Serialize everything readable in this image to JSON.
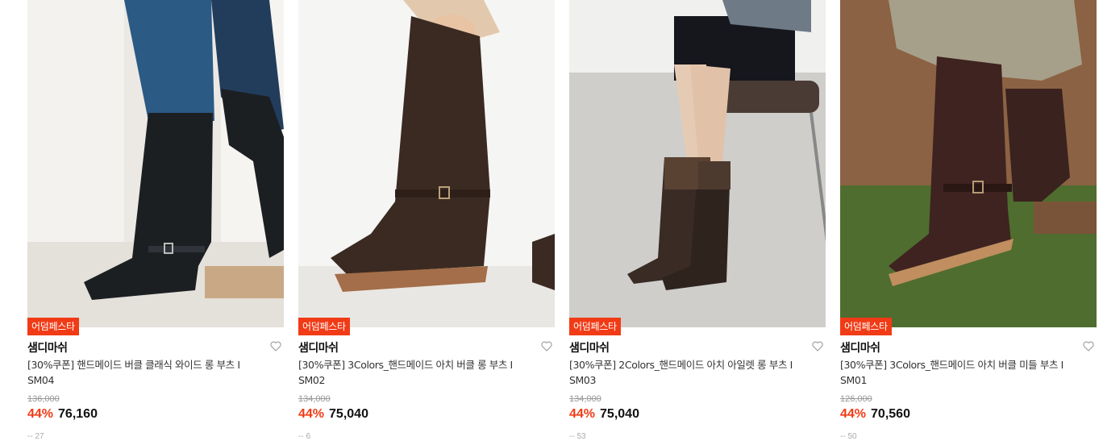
{
  "products": [
    {
      "badge": "어덤페스타",
      "brand": "샘디마쉬",
      "title_line1": "[30%쿠폰] 핸드메이드 버클 클래식 와이드 롱 부츠 I",
      "title_line2": "SM04",
      "original_price": "136,000",
      "discount": "44%",
      "price": "76,160",
      "image_desc": "black long boot, jeans, white curtains",
      "boot_color": "#1c1f22",
      "partial_text": "-- 27"
    },
    {
      "badge": "어덤페스타",
      "brand": "샘디마쉬",
      "title_line1": "[30%쿠폰] 3Colors_핸드메이드 아치 버클 롱 부츠 I",
      "title_line2": "SM02",
      "original_price": "134,000",
      "discount": "44%",
      "price": "75,040",
      "image_desc": "dark brown long boot being pulled on",
      "boot_color": "#3b2a22",
      "partial_text": "-- 6"
    },
    {
      "badge": "어덤페스타",
      "brand": "샘디마쉬",
      "title_line1": "[30%쿠폰] 2Colors_핸드메이드 아치 아일렛 롱 부츠 I",
      "title_line2": "SM03",
      "original_price": "134,000",
      "discount": "44%",
      "price": "75,040",
      "image_desc": "brown two-tone boots, person sitting on chair",
      "boot_color": "#3a2b25",
      "partial_text": "-- 53"
    },
    {
      "badge": "어덤페스타",
      "brand": "샘디마쉬",
      "title_line1": "[30%쿠폰] 3Colors_핸드메이드 아치 버클 미들 부츠 I",
      "title_line2": "SM01",
      "original_price": "126,000",
      "discount": "44%",
      "price": "70,560",
      "image_desc": "brown middle boots on wooden deck with grass",
      "boot_color": "#3e2320",
      "partial_text": "-- 50"
    }
  ],
  "colors": {
    "accent": "#f13b16",
    "badge_bg": "#f13b16",
    "strike": "#999999"
  },
  "icons": {
    "wishlist": "heart-outline-icon"
  }
}
